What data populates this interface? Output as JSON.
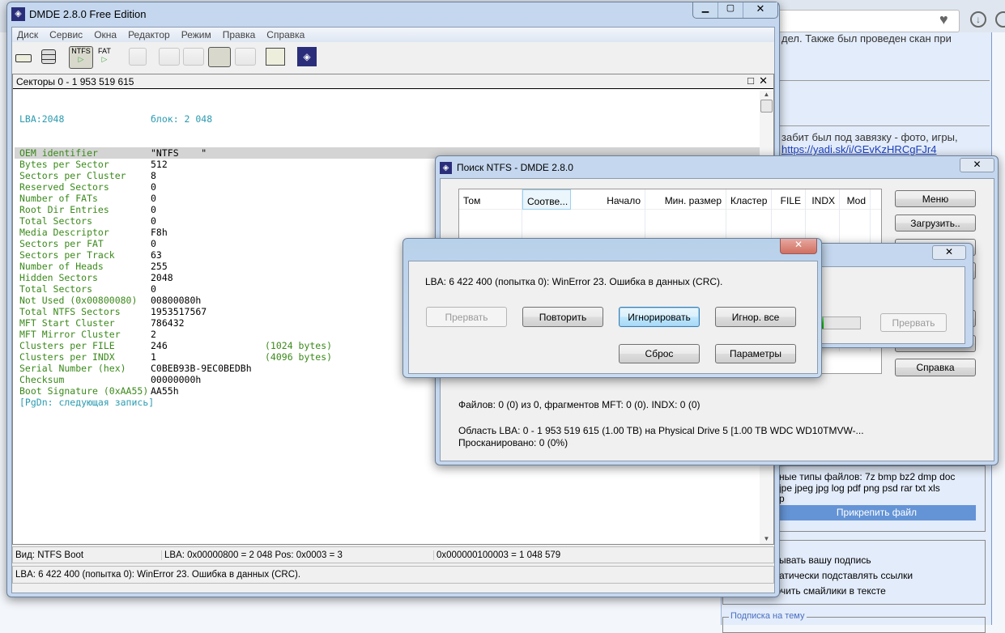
{
  "browser": {
    "text1": "дел. Также был проведен скан при",
    "text2": "забит был под завязку - фото, игры,",
    "link": "https://yadi.sk/i/GEvKzHRCgFJr4",
    "filetypes1": "ные типы файлов: 7z bmp bz2 dmp doc",
    "filetypes2": "jpe jpeg jpg log pdf png psd rar txt xls",
    "filetypes3": "p",
    "attach_button": "Прикрепить файл",
    "opt1": "ывать вашу подпись",
    "opt2": "атически подставлять ссылки",
    "opt3": "Отключить смайлики в тексте",
    "subscribe": "Подписка на тему"
  },
  "main": {
    "title": "DMDE 2.8.0 Free Edition",
    "menu": [
      "Диск",
      "Сервис",
      "Окна",
      "Редактор",
      "Режим",
      "Правка",
      "Справка"
    ],
    "toolbar": {
      "ntfs": "NTFS",
      "fat": "FAT"
    },
    "panel_title": "Секторы 0 - 1 953 519 615",
    "header_left": "LBA:2048",
    "header_right": "блок: 2 048",
    "rows": [
      [
        "OEM identifier",
        "\"NTFS    \"",
        ""
      ],
      [
        "Bytes per Sector",
        "512",
        ""
      ],
      [
        "Sectors per Cluster",
        "8",
        ""
      ],
      [
        "Reserved Sectors",
        "0",
        ""
      ],
      [
        "Number of FATs",
        "0",
        ""
      ],
      [
        "Root Dir Entries",
        "0",
        ""
      ],
      [
        "Total Sectors",
        "0",
        ""
      ],
      [
        "Media Descriptor",
        "F8h",
        ""
      ],
      [
        "Sectors per FAT",
        "0",
        ""
      ],
      [
        "Sectors per Track",
        "63",
        ""
      ],
      [
        "Number of Heads",
        "255",
        ""
      ],
      [
        "Hidden Sectors",
        "2048",
        ""
      ],
      [
        "Total Sectors",
        "0",
        ""
      ],
      [
        "Not Used (0x00800080)",
        "00800080h",
        ""
      ],
      [
        "Total NTFS Sectors",
        "1953517567",
        ""
      ],
      [
        "MFT Start Cluster",
        "786432",
        ""
      ],
      [
        "MFT Mirror Cluster",
        "2",
        ""
      ],
      [
        "Clusters per FILE",
        "246",
        "(1024 bytes)"
      ],
      [
        "Clusters per INDX",
        "1",
        "(4096 bytes)"
      ],
      [
        "Serial Number (hex)",
        "C0BEB93B-9EC0BEDBh",
        ""
      ],
      [
        "Checksum",
        "00000000h",
        ""
      ],
      [
        "Boot Signature (0xAA55)",
        "AA55h",
        ""
      ]
    ],
    "footer_hint": "[PgDn: следующая запись]",
    "status": {
      "view": "Вид: NTFS Boot",
      "lba": "LBA: 0x00000800 = 2 048  Pos: 0x0003 = 3",
      "offset": "0x000000100003 = 1 048 579"
    },
    "message": "LBA: 6 422 400 (попытка 0): WinError 23. Ошибка в данных (CRC)."
  },
  "search": {
    "title": "Поиск NTFS - DMDE 2.8.0",
    "columns": [
      "Том",
      "Соотве...",
      "Начало",
      "Мин. размер",
      "Кластер",
      "FILE",
      "INDX",
      "Mod"
    ],
    "buttons": {
      "menu": "Меню",
      "load": "Загрузить..",
      "help": "Справка"
    },
    "files": "Файлов: 0 (0) из 0, фрагментов MFT: 0 (0). INDX: 0 (0)",
    "area": "Область LBA: 0 - 1 953 519 615 (1.00 TB) на Physical Drive 5 [1.00 TB WDC WD10TMVW-...",
    "scanned": "Просканировано: 0 (0%)"
  },
  "progress": {
    "abort": "Прервать",
    "fraction": 0.25
  },
  "error": {
    "message": "LBA: 6 422 400 (попытка 0): WinError 23. Ошибка в данных (CRC).",
    "abort": "Прервать",
    "retry": "Повторить",
    "ignore": "Игнорировать",
    "ignore_all": "Игнор. все",
    "reset": "Сброс",
    "params": "Параметры"
  }
}
